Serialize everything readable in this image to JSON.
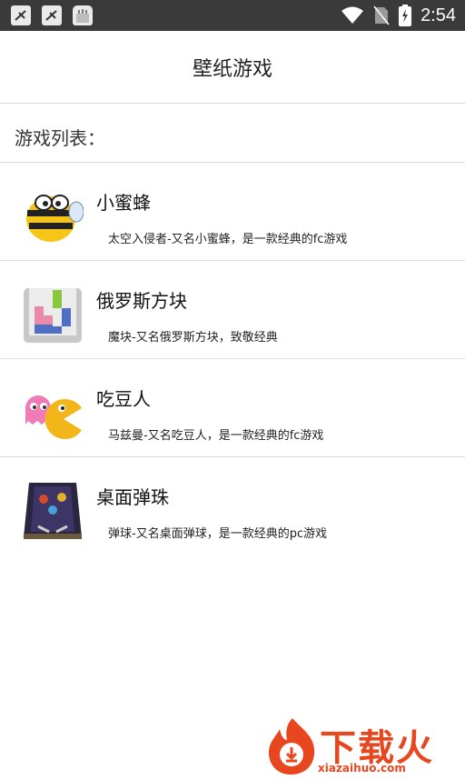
{
  "status_bar": {
    "time": "2:54",
    "icons": [
      "android-download-icon",
      "android-download-icon",
      "bag-icon",
      "wifi-icon",
      "no-sim-icon",
      "battery-charging-icon"
    ]
  },
  "app_bar": {
    "title": "壁纸游戏"
  },
  "section": {
    "label": "游戏列表："
  },
  "games": [
    {
      "name": "小蜜蜂",
      "description": "太空入侵者-又名小蜜蜂，是一款经典的fc游戏",
      "icon": "bee-icon"
    },
    {
      "name": "俄罗斯方块",
      "description": "魔块-又名俄罗斯方块，致敬经典",
      "icon": "tetris-icon"
    },
    {
      "name": "吃豆人",
      "description": "马兹曼-又名吃豆人，是一款经典的fc游戏",
      "icon": "pacman-icon"
    },
    {
      "name": "桌面弹珠",
      "description": "弹球-又名桌面弹球，是一款经典的pc游戏",
      "icon": "pinball-icon"
    }
  ],
  "watermark": {
    "text": "下载火",
    "url": "xiazaihuo.com",
    "color": "#e8461e"
  }
}
